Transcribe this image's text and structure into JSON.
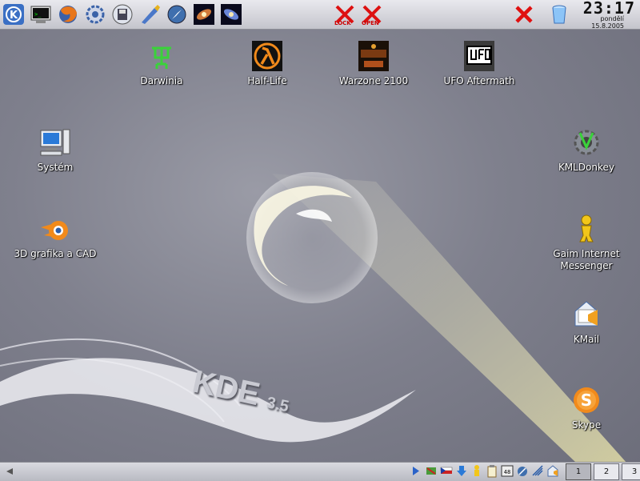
{
  "top_panel": {
    "launchers": [
      {
        "name": "kmenu-icon"
      },
      {
        "name": "terminal-icon"
      },
      {
        "name": "firefox-icon"
      },
      {
        "name": "kde-settings-icon"
      },
      {
        "name": "floppy-icon"
      },
      {
        "name": "brush-icon"
      },
      {
        "name": "compass-icon"
      },
      {
        "name": "galaxy-icon"
      },
      {
        "name": "galaxy-alt-icon"
      }
    ],
    "lock_label": "LOCK",
    "open_label": "OPEN",
    "clock": {
      "time": "23:17",
      "day": "pondělí",
      "date": "15.8.2005"
    }
  },
  "desktop": {
    "icons": [
      {
        "label": "Darwinia",
        "icon": "darwinia-icon"
      },
      {
        "label": "Half-Life",
        "icon": "half-life-icon"
      },
      {
        "label": "Warzone 2100",
        "icon": "warzone-icon"
      },
      {
        "label": "UFO Aftermath",
        "icon": "ufo-icon"
      },
      {
        "label": "Systém",
        "icon": "computer-icon"
      },
      {
        "label": "3D grafika a CAD",
        "icon": "blender-icon"
      },
      {
        "label": "KMLDonkey",
        "icon": "kmldonkey-icon"
      },
      {
        "label": "Gaim Internet Messenger",
        "icon": "gaim-icon"
      },
      {
        "label": "KMail",
        "icon": "kmail-icon"
      },
      {
        "label": "Skype",
        "icon": "skype-icon"
      }
    ],
    "wallpaper_text": "KDE",
    "wallpaper_version": "3.5"
  },
  "bottom_panel": {
    "pager": [
      "1",
      "2",
      "3"
    ],
    "active_desktop": "1"
  },
  "colors": {
    "panel": "#d0d1d8",
    "desktop": "#828390",
    "accent_orange": "#f18a1b"
  }
}
